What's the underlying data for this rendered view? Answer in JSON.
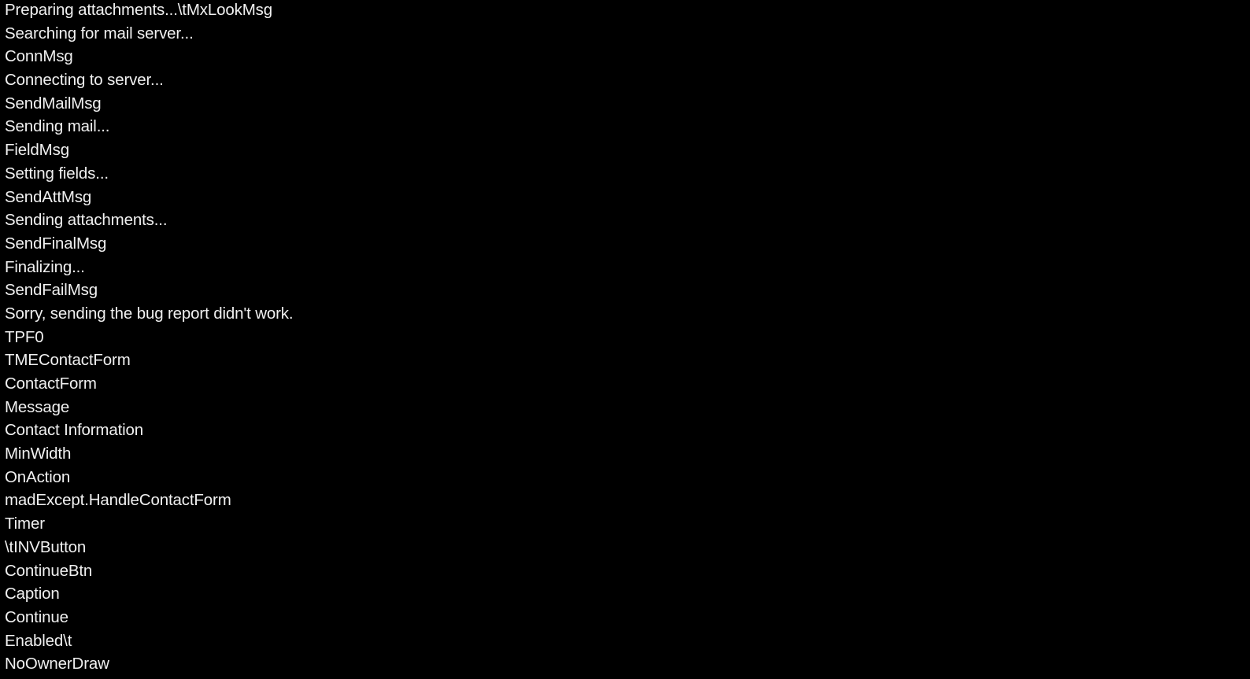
{
  "console": {
    "background_color": "#000000",
    "text_color": "#f0f0f0",
    "top_tint_color": "#05070a",
    "lines": [
      "Preparing attachments...\\tMxLookMsg",
      "Searching for mail server...",
      "ConnMsg",
      "Connecting to server...",
      "SendMailMsg",
      "Sending mail...",
      "FieldMsg",
      "Setting fields...",
      "SendAttMsg",
      "Sending attachments...",
      "SendFinalMsg",
      "Finalizing...",
      "SendFailMsg",
      "Sorry, sending the bug report didn't work.",
      "TPF0",
      "TMEContactForm",
      "ContactForm",
      "Message",
      "Contact Information",
      "MinWidth",
      "OnAction",
      "madExcept.HandleContactForm",
      "Timer",
      "\\tINVButton",
      "ContinueBtn",
      "Caption",
      "Continue",
      "Enabled\\t",
      "NoOwnerDraw"
    ]
  }
}
